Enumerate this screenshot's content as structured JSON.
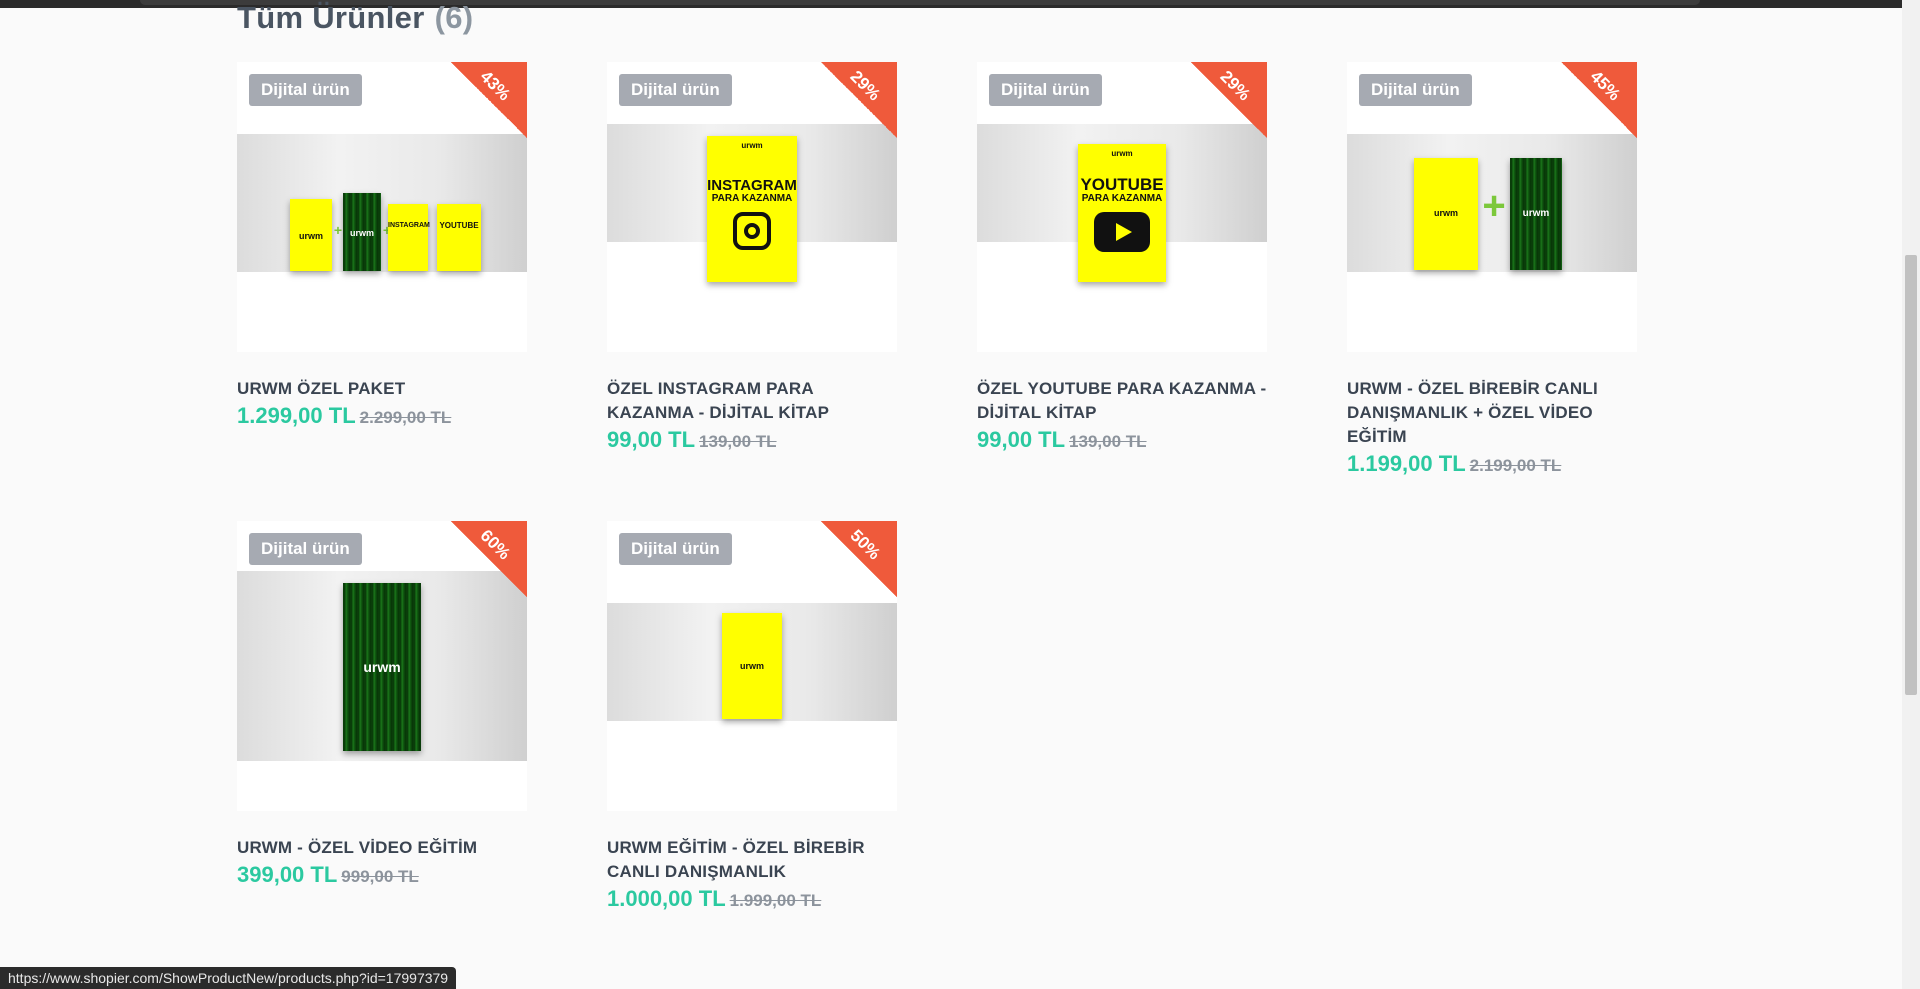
{
  "section": {
    "title": "Tüm Ürünler",
    "count": "(6)"
  },
  "products": [
    {
      "badge": "Dijital ürün",
      "discount": "43%",
      "title": "URWM ÖZEL PAKET",
      "price": "1.299,00 TL",
      "old_price": "2.299,00 TL"
    },
    {
      "badge": "Dijital ürün",
      "discount": "29%",
      "title": "ÖZEL INSTAGRAM PARA KAZANMA - DİJİTAL KİTAP",
      "price": "99,00 TL",
      "old_price": "139,00 TL"
    },
    {
      "badge": "Dijital ürün",
      "discount": "29%",
      "title": "ÖZEL YOUTUBE PARA KAZANMA - DİJİTAL KİTAP",
      "price": "99,00 TL",
      "old_price": "139,00 TL"
    },
    {
      "badge": "Dijital ürün",
      "discount": "45%",
      "title": "URWM - ÖZEL BİREBİR CANLI DANIŞMANLIK + ÖZEL VİDEO EĞİTİM",
      "price": "1.199,00 TL",
      "old_price": "2.199,00 TL"
    },
    {
      "badge": "Dijital ürün",
      "discount": "60%",
      "title": "URWM - ÖZEL VİDEO EĞİTİM",
      "price": "399,00 TL",
      "old_price": "999,00 TL"
    },
    {
      "badge": "Dijital ürün",
      "discount": "50%",
      "title": "URWM EĞİTİM - ÖZEL BİREBİR CANLI DANIŞMANLIK",
      "price": "1.000,00 TL",
      "old_price": "1.999,00 TL"
    }
  ],
  "poster_text": {
    "logo": "urwm",
    "instagram_title": "INSTAGRAM",
    "youtube_title": "YOUTUBE",
    "subtitle": "PARA KAZANMA",
    "plus": "+"
  },
  "status_bar": {
    "url": "https://www.shopier.com/ShowProductNew/products.php?id=17997379"
  },
  "colors": {
    "accent_price": "#2bc9a0",
    "ribbon": "#ef5a3b",
    "badge": "#a6aab2",
    "poster_yellow": "#ffff00"
  }
}
